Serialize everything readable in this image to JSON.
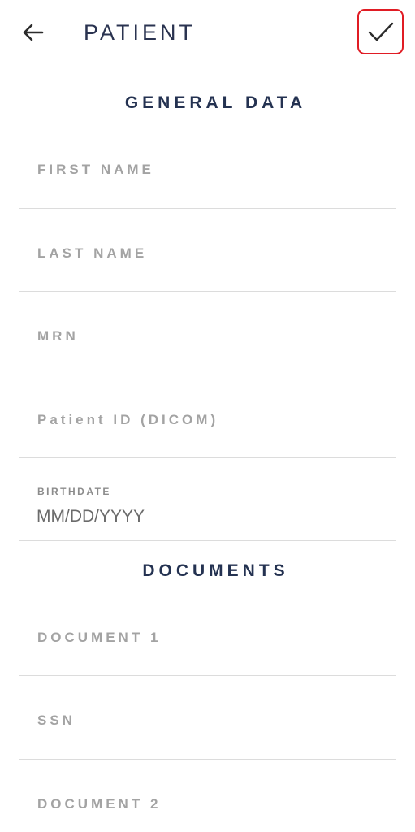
{
  "header": {
    "title": "PATIENT",
    "back_icon": "arrow-left-icon",
    "confirm_icon": "check-icon"
  },
  "colors": {
    "title": "#2a3350",
    "section_title": "#243251",
    "label": "#a3a3a3",
    "divider": "#dcdcdc",
    "highlight_border": "#e01c24"
  },
  "sections": {
    "general": {
      "title": "GENERAL DATA",
      "fields": {
        "first_name": "FIRST NAME",
        "last_name": "LAST NAME",
        "mrn": "MRN",
        "patient_id": "Patient ID (DICOM)",
        "birthdate_label": "BIRTHDATE",
        "birthdate_placeholder": "MM/DD/YYYY"
      }
    },
    "documents": {
      "title": "DOCUMENTS",
      "fields": {
        "document1": "DOCUMENT 1",
        "ssn": "SSN",
        "document2": "DOCUMENT 2"
      }
    }
  }
}
